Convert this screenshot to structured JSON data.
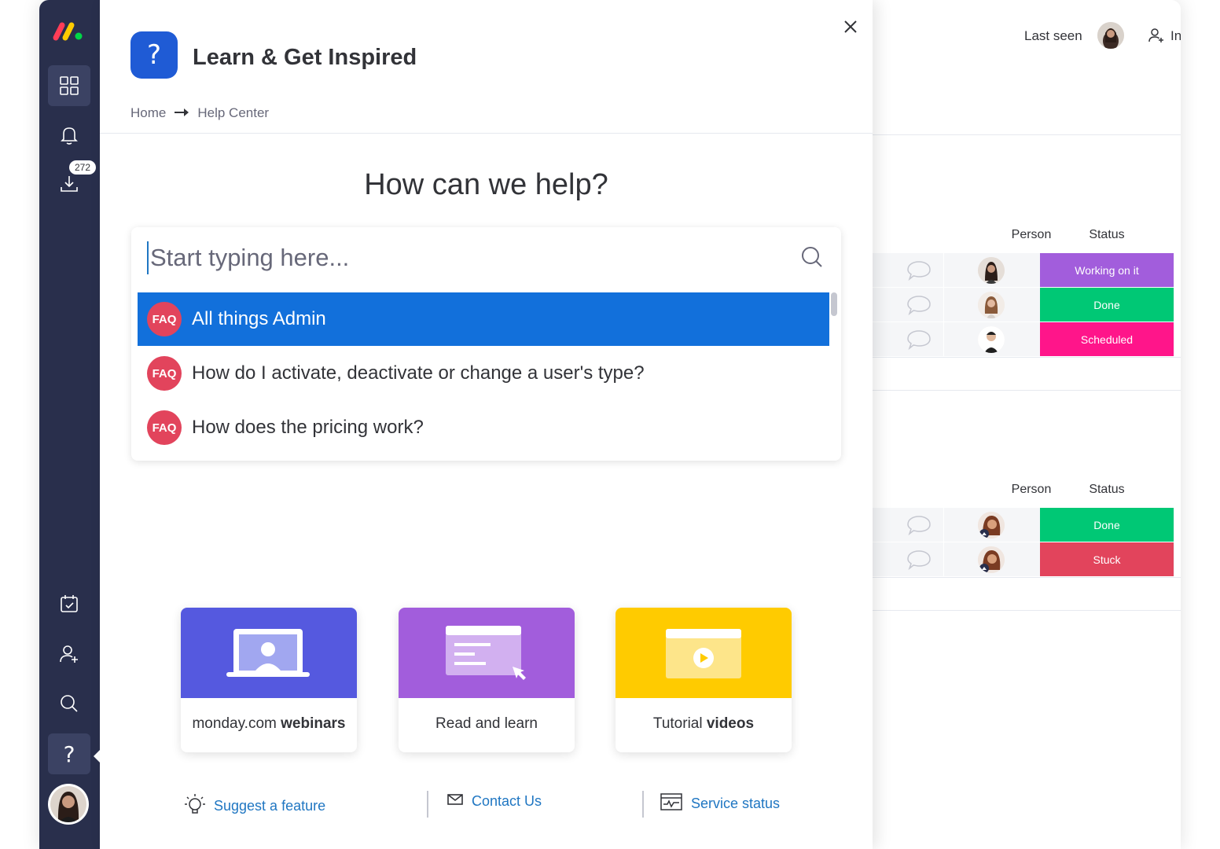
{
  "panel": {
    "title": "Learn & Get Inspired",
    "help_icon_glyph": "?",
    "breadcrumb": {
      "home": "Home",
      "current": "Help Center"
    },
    "headline": "How can we help?",
    "search": {
      "placeholder": "Start typing here..."
    },
    "results": [
      {
        "badge": "FAQ",
        "text": "All things Admin",
        "selected": true
      },
      {
        "badge": "FAQ",
        "text": "How do I activate, deactivate or change a user's type?",
        "selected": false
      },
      {
        "badge": "FAQ",
        "text": "How does the pricing work?",
        "selected": false
      }
    ],
    "cards": [
      {
        "pre": "monday.com ",
        "bold": "webinars",
        "color": "#5559df",
        "icon": "laptop-illustration"
      },
      {
        "pre": "Read and learn",
        "bold": "",
        "color": "#a25ddc",
        "icon": "article-illustration"
      },
      {
        "pre": "Tutorial ",
        "bold": "videos",
        "color": "#ffcb00",
        "icon": "video-illustration"
      }
    ],
    "footer": {
      "suggest": "Suggest a feature",
      "contact": "Contact Us",
      "status": "Service status"
    }
  },
  "nav": {
    "badge_count": "272",
    "help_glyph": "?"
  },
  "board": {
    "last_seen_label": "Last seen",
    "invite_label": "In",
    "groups": [
      {
        "person_header": "Person",
        "status_header": "Status",
        "rows": [
          {
            "status": "Working on it",
            "color": "#a25ddc"
          },
          {
            "status": "Done",
            "color": "#00c875"
          },
          {
            "status": "Scheduled",
            "color": "#ff158a"
          }
        ]
      },
      {
        "person_header": "Person",
        "status_header": "Status",
        "rows": [
          {
            "status": "Done",
            "color": "#00c875"
          },
          {
            "status": "Stuck",
            "color": "#e2445c"
          }
        ]
      }
    ]
  },
  "colors": {
    "nav_bg": "#292f4c",
    "accent": "#1f76c2",
    "selected_result": "#1270db",
    "faq_badge": "#e2445c"
  }
}
